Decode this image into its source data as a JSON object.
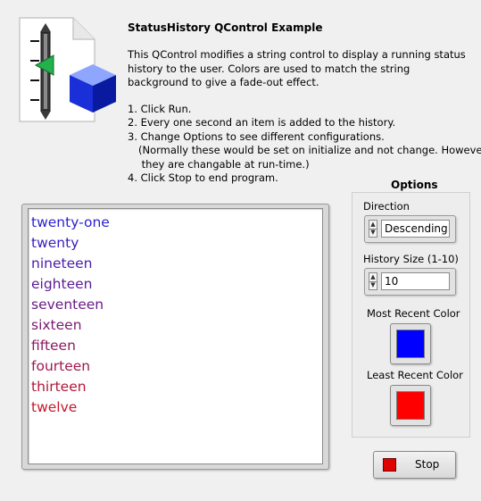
{
  "header": {
    "icon": "slider-cube-icon",
    "title": "StatusHistory QControl Example",
    "description": "This QControl modifies a string control to display a running status history to the user.  Colors are used to match the string background to give a fade-out effect.",
    "steps": [
      "1. Click Run.",
      "2. Every one second an item is added to the history.",
      "3. Change Options to see different configurations."
    ],
    "note_lines": [
      "(Normally these would be set on initialize and not change.  However,",
      " they are changable at run-time.)"
    ],
    "last_step": "4. Click Stop to end program."
  },
  "history": {
    "items": [
      {
        "text": "twenty-one",
        "color": "#2a1fd0"
      },
      {
        "text": "twenty",
        "color": "#3a1dbe"
      },
      {
        "text": "nineteen",
        "color": "#4a1baa"
      },
      {
        "text": "eighteen",
        "color": "#5a1a98"
      },
      {
        "text": "seventeen",
        "color": "#6a1a86"
      },
      {
        "text": "sixteen",
        "color": "#7a1972"
      },
      {
        "text": "fifteen",
        "color": "#8c1862"
      },
      {
        "text": "fourteen",
        "color": "#a0184e"
      },
      {
        "text": "thirteen",
        "color": "#b2173a"
      },
      {
        "text": "twelve",
        "color": "#c8162a"
      }
    ]
  },
  "options": {
    "title": "Options",
    "direction": {
      "label": "Direction",
      "value": "Descending"
    },
    "history_size": {
      "label": "History Size (1-10)",
      "value": "10"
    },
    "most_recent_color": {
      "label": "Most Recent Color",
      "color": "#0000ff"
    },
    "least_recent_color": {
      "label": "Least Recent Color",
      "color": "#ff0000"
    }
  },
  "stop": {
    "label": "Stop",
    "led_color": "#e00000"
  }
}
